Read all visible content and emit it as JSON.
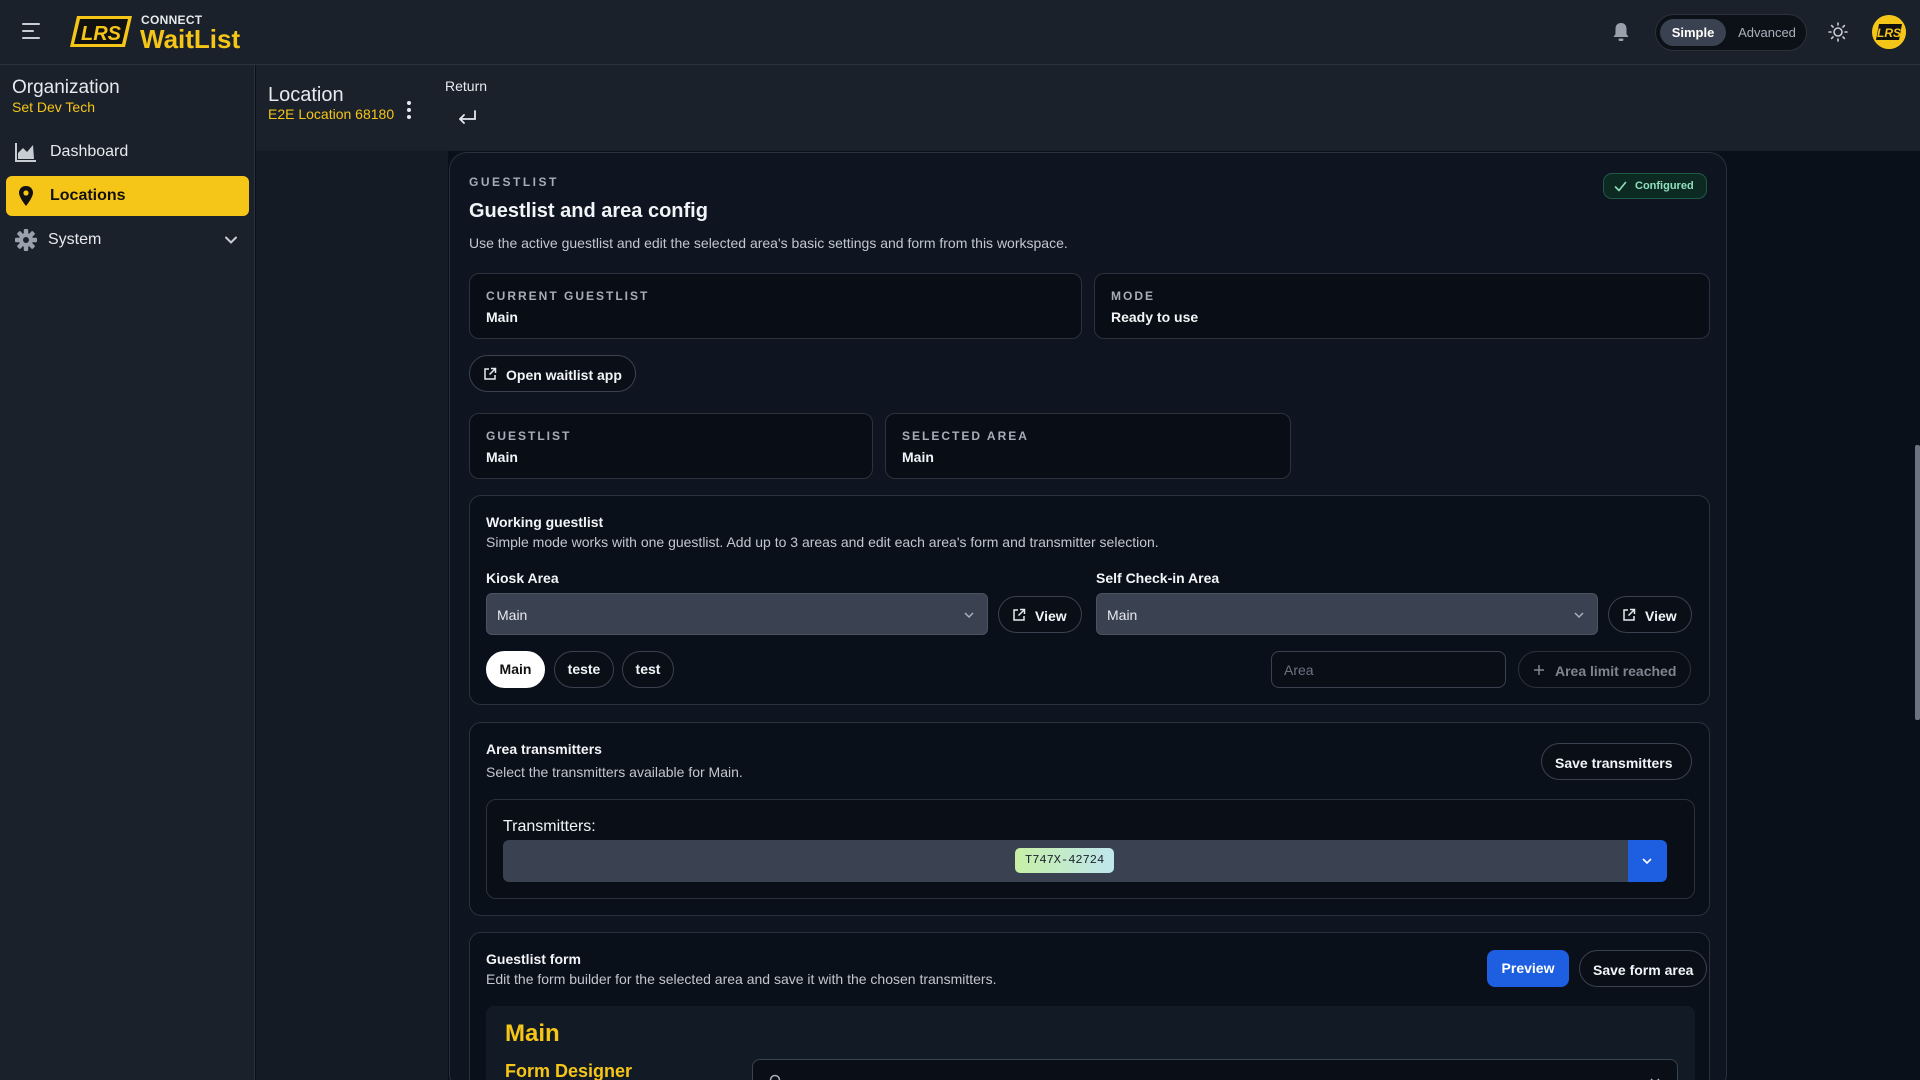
{
  "app": {
    "brand_small": "CONNECT",
    "brand_big": "WaitList",
    "logo_text": "LRS"
  },
  "header": {
    "mode_simple": "Simple",
    "mode_advanced": "Advanced"
  },
  "sidebar": {
    "org_title": "Organization",
    "org_name": "Set Dev Tech",
    "items": [
      {
        "label": "Dashboard",
        "icon": "chart-area-icon"
      },
      {
        "label": "Locations",
        "icon": "map-pin-icon",
        "active": true
      },
      {
        "label": "System",
        "icon": "gear-icon"
      }
    ]
  },
  "location": {
    "title": "Location",
    "name": "E2E Location 68180",
    "return_label": "Return"
  },
  "card": {
    "eyebrow": "GUESTLIST",
    "title": "Guestlist and area config",
    "description": "Use the active guestlist and edit the selected area's basic settings and form from this workspace.",
    "badge": "Configured",
    "stats_top": [
      {
        "key": "CURRENT GUESTLIST",
        "value": "Main"
      },
      {
        "key": "MODE",
        "value": "Ready to use"
      }
    ],
    "open_app_label": "Open waitlist app",
    "stats_mid": [
      {
        "key": "GUESTLIST",
        "value": "Main"
      },
      {
        "key": "SELECTED AREA",
        "value": "Main"
      }
    ]
  },
  "working": {
    "title": "Working guestlist",
    "description": "Simple mode works with one guestlist. Add up to 3 areas and edit each area's form and transmitter selection.",
    "kiosk_label": "Kiosk Area",
    "kiosk_value": "Main",
    "self_label": "Self Check-in Area",
    "self_value": "Main",
    "view_label": "View",
    "areas": [
      "Main",
      "teste",
      "test"
    ],
    "area_placeholder": "Area",
    "limit_label": "Area limit reached"
  },
  "transmitters": {
    "title": "Area transmitters",
    "description": "Select the transmitters available for Main.",
    "save_label": "Save transmitters",
    "field_label": "Transmitters:",
    "selected": [
      "T747X-42724"
    ]
  },
  "form": {
    "title": "Guestlist form",
    "description": "Edit the form builder for the selected area and save it with the chosen transmitters.",
    "preview_label": "Preview",
    "save_label": "Save form area",
    "designer_title": "Main",
    "designer_sub": "Form Designer"
  },
  "colors": {
    "accent": "#f5c518",
    "primary": "#1d5fe0",
    "success": "#8ee0bd"
  }
}
